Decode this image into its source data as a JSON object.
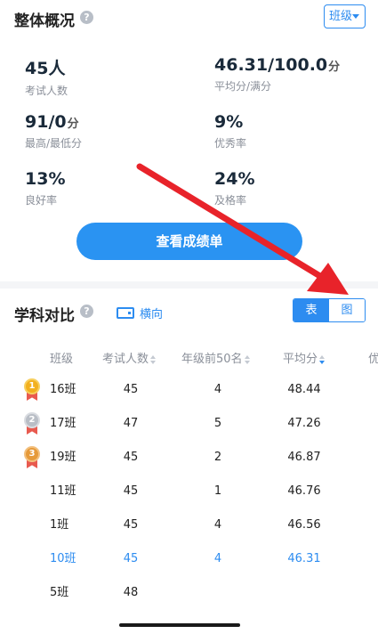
{
  "overview": {
    "title": "整体概况",
    "help": "?",
    "class_selector": "班级",
    "stats": [
      {
        "value": "45人",
        "unit": "",
        "label": "考试人数"
      },
      {
        "value": "46.31/100.0",
        "unit": "分",
        "label": "平均分/满分"
      },
      {
        "value": "91/0",
        "unit": "分",
        "label": "最高/最低分"
      },
      {
        "value": "9%",
        "unit": "",
        "label": "优秀率"
      },
      {
        "value": "13%",
        "unit": "",
        "label": "良好率"
      },
      {
        "value": "24%",
        "unit": "",
        "label": "及格率"
      }
    ],
    "report_button": "查看成绩单"
  },
  "compare": {
    "title": "学科对比",
    "help": "?",
    "landscape_label": "横向",
    "view_toggle": {
      "table": "表",
      "chart": "图",
      "selected": "table"
    },
    "columns": [
      "班级",
      "考试人数",
      "年级前50名",
      "平均分",
      "优"
    ],
    "rows": [
      {
        "rank": "1",
        "medal": "gold",
        "name": "16班",
        "count": "45",
        "top50": "4",
        "avg": "48.44"
      },
      {
        "rank": "2",
        "medal": "silver",
        "name": "17班",
        "count": "47",
        "top50": "5",
        "avg": "47.26"
      },
      {
        "rank": "3",
        "medal": "bronze",
        "name": "19班",
        "count": "45",
        "top50": "2",
        "avg": "46.87"
      },
      {
        "rank": "",
        "medal": "",
        "name": "11班",
        "count": "45",
        "top50": "1",
        "avg": "46.76"
      },
      {
        "rank": "",
        "medal": "",
        "name": "1班",
        "count": "45",
        "top50": "4",
        "avg": "46.56"
      },
      {
        "rank": "",
        "medal": "",
        "name": "10班",
        "count": "45",
        "top50": "4",
        "avg": "46.31",
        "highlight": true
      },
      {
        "rank": "",
        "medal": "",
        "name": "5班",
        "count": "48",
        "top50": "",
        "avg": ""
      }
    ]
  },
  "colors": {
    "accent": "#2d8cf0",
    "button": "#2a93f2",
    "annotation_arrow": "#e8232a"
  }
}
